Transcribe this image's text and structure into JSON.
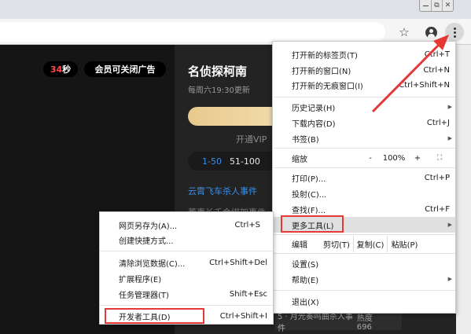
{
  "window": {
    "restore_glyph": "⧉",
    "close_glyph": "✕"
  },
  "toolbar": {
    "star_icon": "☆",
    "icons": [
      "star-icon",
      "profile-icon",
      "three-dots-menu-icon"
    ]
  },
  "page": {
    "timer_value": "34",
    "timer_unit": "秒",
    "ad_close": "会员可关闭广告",
    "show_title": "名侦探柯南",
    "show_update": "每周六19:30更新",
    "vip_text": "开通VIP",
    "ep_tabs": [
      "1-50",
      "51-100"
    ],
    "ep_link": "云霄飞车杀人事件",
    "ep_faded": "董事长千金绑架事件",
    "hot_episode": "5 · 月光奏鸣曲杀人事件",
    "hot_heat": "热度 696"
  },
  "menu": {
    "new_tab": "打开新的标签页(T)",
    "new_tab_sc": "Ctrl+T",
    "new_window": "打开新的窗口(N)",
    "new_window_sc": "Ctrl+N",
    "incognito": "打开新的无痕窗口(I)",
    "incognito_sc": "Ctrl+Shift+N",
    "history": "历史记录(H)",
    "downloads": "下载内容(D)",
    "downloads_sc": "Ctrl+J",
    "bookmarks": "书签(B)",
    "zoom": "缩放",
    "zoom_minus": "-",
    "zoom_value": "100%",
    "zoom_plus": "+",
    "fullscreen_glyph": "⛶",
    "print": "打印(P)...",
    "print_sc": "Ctrl+P",
    "cast": "投射(C)...",
    "find": "查找(F)...",
    "find_sc": "Ctrl+F",
    "more_tools": "更多工具(L)",
    "edit": "编辑",
    "cut": "剪切(T)",
    "copy": "复制(C)",
    "paste": "粘贴(P)",
    "settings": "设置(S)",
    "help": "帮助(E)",
    "exit": "退出(X)"
  },
  "submenu": {
    "save_as": "网页另存为(A)...",
    "save_as_sc": "Ctrl+S",
    "shortcut": "创建快捷方式...",
    "clear_data": "清除浏览数据(C)...",
    "clear_data_sc": "Ctrl+Shift+Del",
    "extensions": "扩展程序(E)",
    "task_manager": "任务管理器(T)",
    "task_manager_sc": "Shift+Esc",
    "devtools": "开发者工具(D)",
    "devtools_sc": "Ctrl+Shift+I"
  },
  "colors": {
    "highlight_red": "#e53935",
    "link_blue": "#3b8fe8",
    "vip_gold": "#e8c98d"
  }
}
